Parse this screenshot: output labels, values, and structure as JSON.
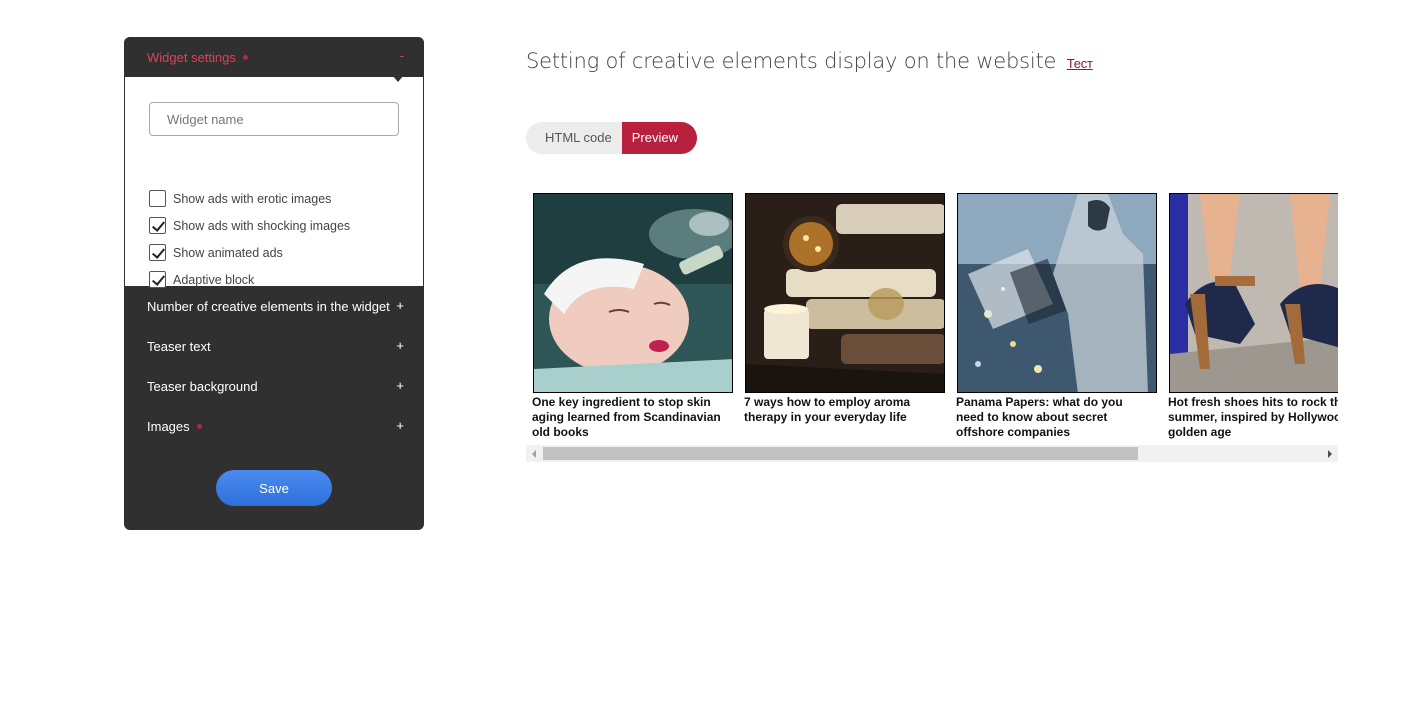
{
  "panel": {
    "header": {
      "title": "Widget settings",
      "toggle": "-"
    },
    "widget_name": {
      "value": "",
      "placeholder": "Widget name"
    },
    "checkboxes": [
      {
        "label": "Show ads with erotic images",
        "checked": false
      },
      {
        "label": "Show ads with shocking images",
        "checked": true
      },
      {
        "label": "Show animated ads",
        "checked": true
      },
      {
        "label": "Adaptive block",
        "checked": true
      }
    ],
    "sections": [
      {
        "label": "Number of creative elements in the widget",
        "toggle": "+"
      },
      {
        "label": "Teaser text",
        "toggle": "+"
      },
      {
        "label": "Teaser background",
        "toggle": "+"
      },
      {
        "label": "Images",
        "toggle": "+",
        "has_dot": true
      }
    ],
    "save_label": "Save"
  },
  "main": {
    "title": "Setting of creative elements display on the website",
    "title_link": "Тест",
    "tabs": [
      {
        "label": "HTML code",
        "active": false
      },
      {
        "label": "Preview",
        "active": true
      }
    ],
    "teasers": [
      {
        "caption": "One key ingredient to stop skin aging learned from Scandinavian old books"
      },
      {
        "caption": "7 ways how to employ aroma therapy in your everyday life"
      },
      {
        "caption": "Panama Papers: what do you need to know about secret offshore companies"
      },
      {
        "caption": "Hot fresh shoes hits to rock this summer, inspired by Hollywood golden age"
      }
    ]
  },
  "colors": {
    "accent": "#b8203e",
    "accent_text": "#e0405a",
    "panel_bg": "#303030",
    "save_button": "#3b7de6"
  }
}
